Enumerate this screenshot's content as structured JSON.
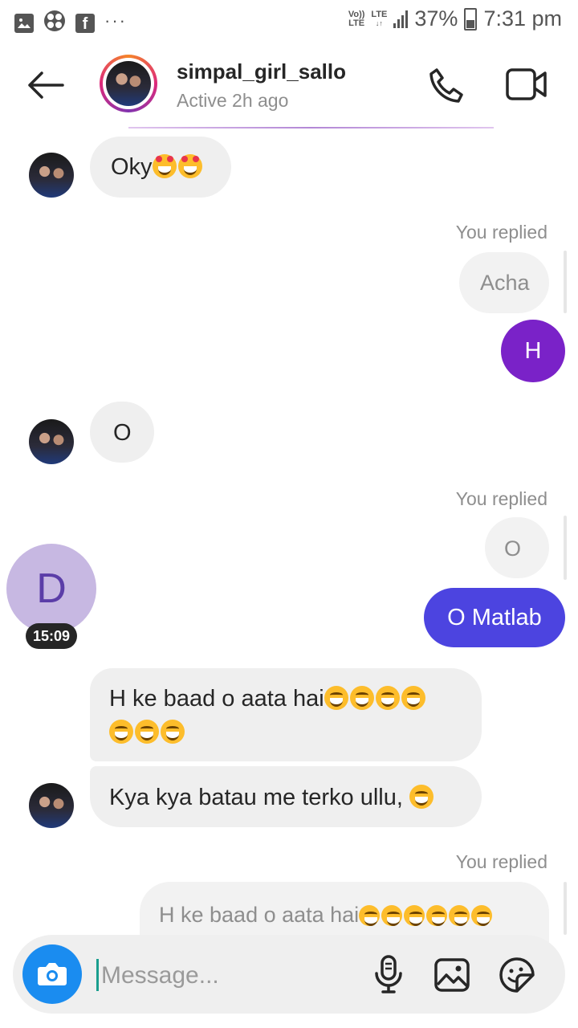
{
  "status_bar": {
    "network_top": "Vo))",
    "network_bottom": "LTE",
    "lte_top": "LTE",
    "lte_arrows": "↓↑",
    "battery": "37%",
    "time": "7:31 pm",
    "icons": [
      "gallery-icon",
      "pinwheel-icon",
      "facebook-icon",
      "more-dots-icon",
      "signal-icon",
      "battery-icon"
    ]
  },
  "header": {
    "username": "simpal_girl_sallo",
    "status": "Active 2h ago",
    "back_icon": "back-arrow-icon",
    "call_icon": "phone-icon",
    "video_icon": "video-camera-icon"
  },
  "messages": {
    "m1_text": "Oky",
    "replied_1": "You replied",
    "quote_1": "Acha",
    "sent_1": "H",
    "m2_text": "O",
    "replied_2": "You replied",
    "quote_2": "O",
    "sent_2": "O Matlab",
    "m3_line1": "H ke baad o aata hai",
    "m4_text": "Kya kya batau me terko ullu,",
    "replied_3": "You replied",
    "quote_3": "H ke baad o aata hai"
  },
  "call_bubble": {
    "initial": "D",
    "time": "15:09"
  },
  "composer": {
    "placeholder": "Message...",
    "icons": [
      "camera-icon",
      "microphone-icon",
      "image-icon",
      "sticker-icon"
    ]
  },
  "colors": {
    "sent_purple": "#7a22c8",
    "sent_blue": "#4c44e0",
    "camera_blue": "#1a8cf0",
    "received_bg": "#efefef"
  }
}
